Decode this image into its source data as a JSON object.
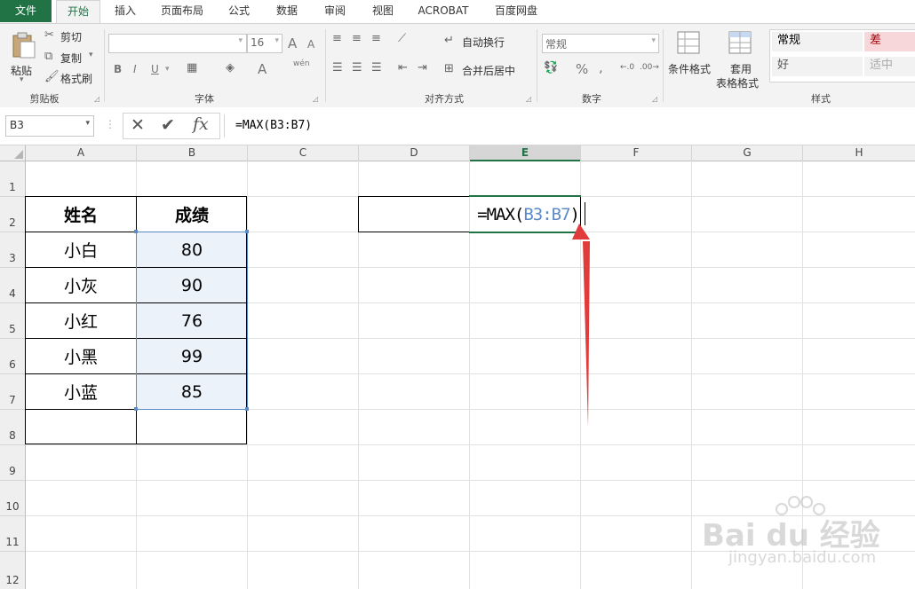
{
  "tabs": [
    "文件",
    "开始",
    "插入",
    "页面布局",
    "公式",
    "数据",
    "审阅",
    "视图",
    "ACROBAT",
    "百度网盘"
  ],
  "clipboard": {
    "paste": "粘贴",
    "cut": "剪切",
    "copy": "复制",
    "format_painter": "格式刷",
    "label": "剪贴板"
  },
  "font": {
    "size": "16",
    "label": "字体",
    "bold": "B",
    "italic": "I",
    "underline": "U",
    "grow": "A",
    "shrink": "A",
    "font_color": "A",
    "phonetic": "wén"
  },
  "alignment": {
    "wrap": "自动换行",
    "merge": "合并后居中",
    "label": "对齐方式"
  },
  "number": {
    "format": "常规",
    "percent": "%",
    "comma": ",",
    "label": "数字"
  },
  "styles_group": {
    "conditional": "条件格式",
    "table_format_1": "套用",
    "table_format_2": "表格格式",
    "label": "样式",
    "cells": [
      {
        "text": "常规",
        "bg": "#f2f2f2",
        "color": "#333"
      },
      {
        "text": "差",
        "bg": "#f8d7da",
        "color": "#9c0006"
      },
      {
        "text": "好",
        "bg": "#e6f4ea",
        "color": "#006100"
      },
      {
        "text": "适中",
        "bg": "#fff2cc",
        "color": "#9c5700"
      }
    ]
  },
  "formula_bar": {
    "name_box": "B3",
    "cancel": "✕",
    "enter": "✔",
    "fx": "fx",
    "formula": "=MAX(B3:B7)"
  },
  "columns": [
    "A",
    "B",
    "C",
    "D",
    "E",
    "F",
    "G",
    "H"
  ],
  "rows": [
    "1",
    "2",
    "3",
    "4",
    "5",
    "6",
    "7",
    "8",
    "9",
    "10",
    "11",
    "12"
  ],
  "table": {
    "headers": [
      "姓名",
      "成绩"
    ],
    "rows": [
      [
        "小白",
        "80"
      ],
      [
        "小灰",
        "90"
      ],
      [
        "小红",
        "76"
      ],
      [
        "小黑",
        "99"
      ],
      [
        "小蓝",
        "85"
      ]
    ]
  },
  "editing_cell": {
    "prefix": "=MAX(",
    "ref": "B3:B7",
    "suffix": ")"
  },
  "colors": {
    "excel_green": "#217346",
    "ref_blue": "#5b8ac8",
    "selection_fill": "#ebf2fa",
    "arrow_red": "#e03c3c"
  },
  "watermark": {
    "brand": "Bai du 经验",
    "url": "jingyan.baidu.com"
  }
}
